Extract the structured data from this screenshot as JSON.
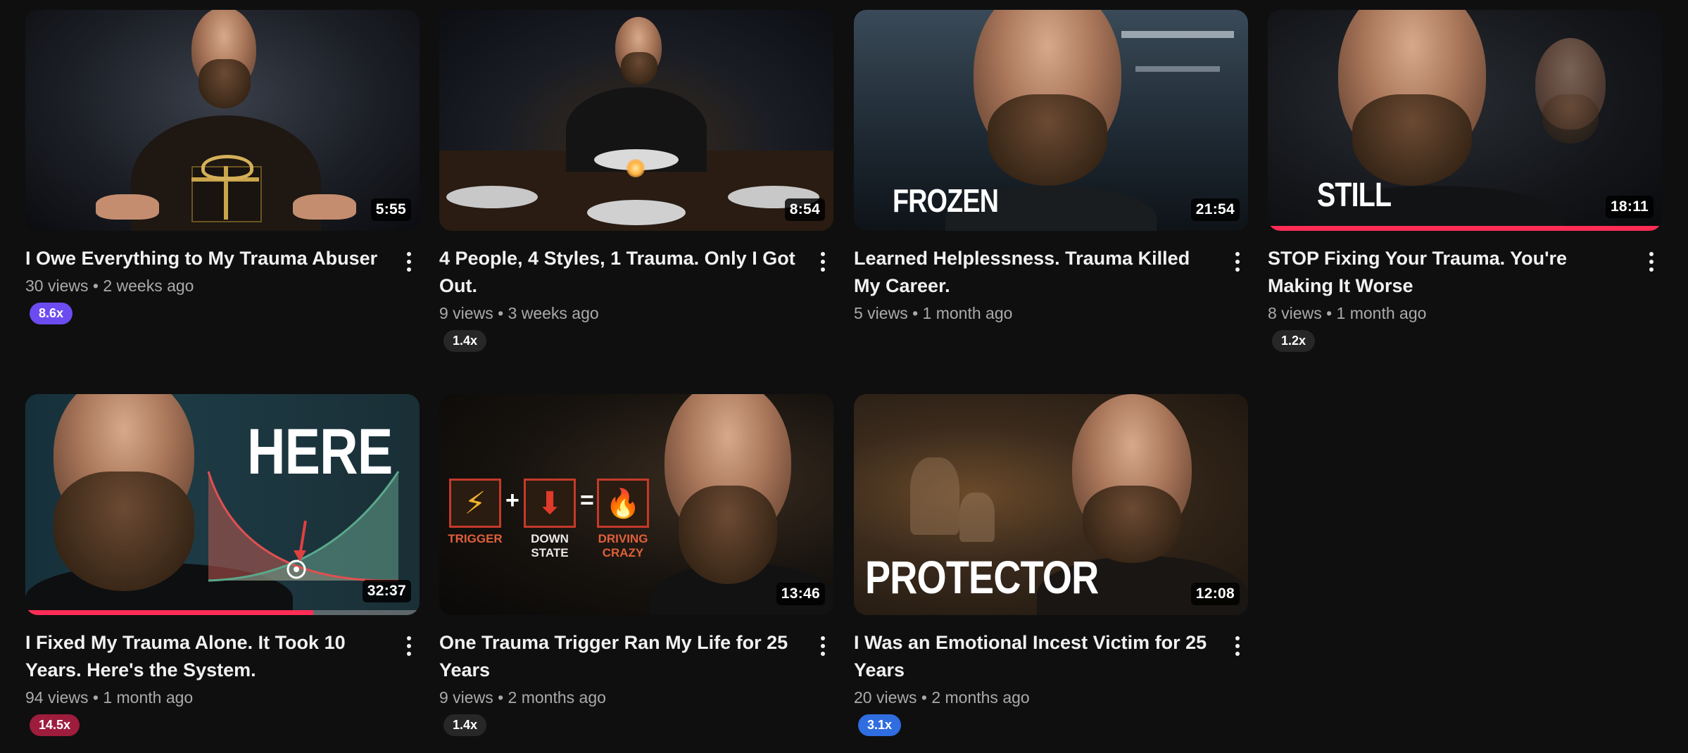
{
  "videos": [
    {
      "title": "I Owe Everything to My Trauma Abuser",
      "views": "30 views",
      "age": "2 weeks ago",
      "duration": "5:55",
      "badge": "8.6x",
      "badge_color": "#6c4cf1",
      "overlay": ""
    },
    {
      "title": "4 People, 4 Styles, 1 Trauma. Only I Got Out.",
      "views": "9 views",
      "age": "3 weeks ago",
      "duration": "8:54",
      "badge": "1.4x",
      "badge_color": "#272727",
      "overlay": ""
    },
    {
      "title": "Learned Helplessness. Trauma Killed My Career.",
      "views": "5 views",
      "age": "1 month ago",
      "duration": "21:54",
      "badge": "",
      "badge_color": "",
      "overlay": "FROZEN"
    },
    {
      "title": "STOP Fixing Your Trauma. You're Making It Worse",
      "views": "8 views",
      "age": "1 month ago",
      "duration": "18:11",
      "badge": "1.2x",
      "badge_color": "#272727",
      "overlay": "STILL",
      "watched_fraction": 1.0
    },
    {
      "title": "I Fixed My Trauma Alone. It Took 10 Years. Here's the System.",
      "views": "94 views",
      "age": "1 month ago",
      "duration": "32:37",
      "badge": "14.5x",
      "badge_color": "#9e1c3c",
      "overlay": "HERE",
      "watched_fraction": 0.73
    },
    {
      "title": "One Trauma Trigger Ran My Life for 25 Years",
      "views": "9 views",
      "age": "2 months ago",
      "duration": "13:46",
      "badge": "1.4x",
      "badge_color": "#272727",
      "overlay": "",
      "labels": [
        "TRIGGER",
        "DOWN STATE",
        "DRIVING CRAZY"
      ]
    },
    {
      "title": "I Was an Emotional Incest Victim for 25 Years",
      "views": "20 views",
      "age": "2 months ago",
      "duration": "12:08",
      "badge": "3.1x",
      "badge_color": "#2f6de0",
      "overlay": "PROTECTOR"
    }
  ],
  "separator": "•"
}
